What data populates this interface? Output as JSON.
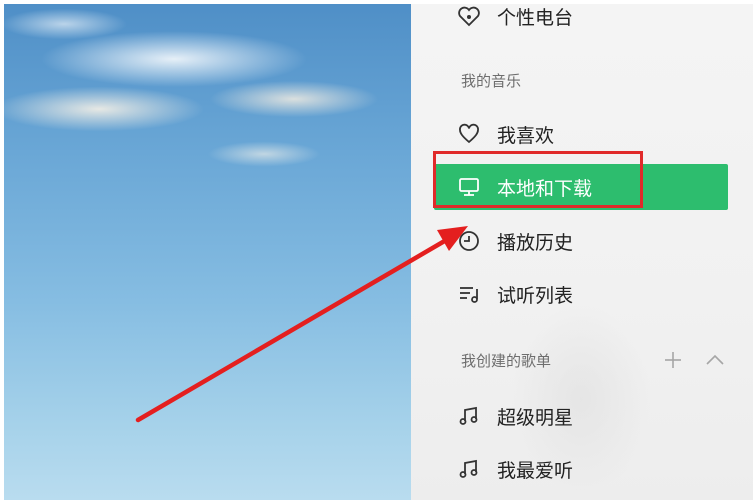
{
  "sidebar": {
    "top_item": {
      "label": "个性电台",
      "icon": "radio-heart-icon"
    },
    "section_my_music": "我的音乐",
    "items": [
      {
        "label": "我喜欢",
        "icon": "heart-icon"
      },
      {
        "label": "本地和下载",
        "icon": "monitor-icon",
        "active": true
      },
      {
        "label": "播放历史",
        "icon": "clock-icon"
      },
      {
        "label": "试听列表",
        "icon": "playlist-icon"
      }
    ],
    "section_created": "我创建的歌单",
    "created_actions": [
      "add-icon",
      "collapse-icon"
    ],
    "playlists": [
      {
        "label": "超级明星",
        "icon": "music-note-icon"
      },
      {
        "label": "我最爱听",
        "icon": "music-note-icon"
      }
    ]
  },
  "annotations": {
    "highlight_color": "#e02a2a",
    "active_color": "#2dbd6e"
  }
}
